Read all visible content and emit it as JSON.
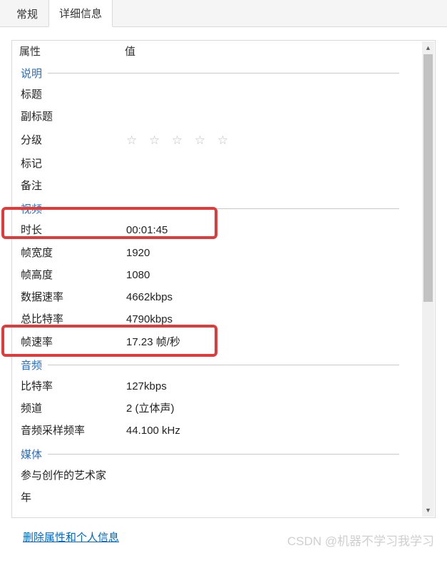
{
  "tabs": {
    "general": "常规",
    "details": "详细信息"
  },
  "columns": {
    "property": "属性",
    "value": "值"
  },
  "sections": {
    "description": "说明",
    "video": "视频",
    "audio": "音频",
    "media": "媒体"
  },
  "desc": {
    "title_label": "标题",
    "subtitle_label": "副标题",
    "rating_label": "分级",
    "tags_label": "标记",
    "comments_label": "备注"
  },
  "video": {
    "duration_label": "时长",
    "duration_value": "00:01:45",
    "width_label": "帧宽度",
    "width_value": "1920",
    "height_label": "帧高度",
    "height_value": "1080",
    "datarate_label": "数据速率",
    "datarate_value": "4662kbps",
    "bitrate_label": "总比特率",
    "bitrate_value": "4790kbps",
    "framerate_label": "帧速率",
    "framerate_value": "17.23 帧/秒"
  },
  "audio": {
    "bitrate_label": "比特率",
    "bitrate_value": "127kbps",
    "channels_label": "频道",
    "channels_value": "2 (立体声)",
    "samplerate_label": "音频采样频率",
    "samplerate_value": "44.100 kHz"
  },
  "media": {
    "artist_label": "参与创作的艺术家",
    "year_label": "年"
  },
  "footer": {
    "remove_link": "删除属性和个人信息"
  },
  "stars": "☆ ☆ ☆ ☆ ☆",
  "watermark": "CSDN @机器不学习我学习"
}
